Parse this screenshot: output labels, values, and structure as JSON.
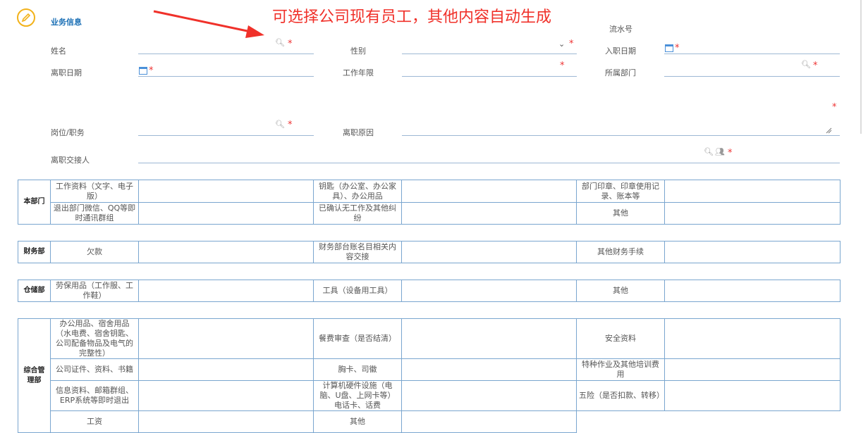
{
  "header": {
    "section_title": "业务信息",
    "annotation": "可选择公司现有员工，其他内容自动生成"
  },
  "form": {
    "serial_label": "流水号",
    "name_label": "姓名",
    "gender_label": "性别",
    "hire_date_label": "入职日期",
    "leave_date_label": "离职日期",
    "work_years_label": "工作年限",
    "department_label": "所属部门",
    "position_label": "岗位/职务",
    "leave_reason_label": "离职原因",
    "handover_label": "离职交接人",
    "required_mark": "*"
  },
  "tables": [
    {
      "dept": "本部门",
      "rows": [
        [
          "工作资料（文字、电子版）",
          "钥匙（办公室、办公家具）、办公用品",
          "部门印章、印章使用记录、账本等"
        ],
        [
          "退出部门微信、QQ等即时通讯群组",
          "已确认无工作及其他纠纷",
          "其他"
        ]
      ]
    },
    {
      "dept": "财务部",
      "rows": [
        [
          "欠款",
          "财务部台账名目相关内容交接",
          "其他财务手续"
        ]
      ]
    },
    {
      "dept": "仓储部",
      "rows": [
        [
          "劳保用品（工作服、工作鞋）",
          "工具（设备用工具）",
          "其他"
        ]
      ]
    },
    {
      "dept": "综合管理部",
      "rows": [
        [
          "办公用品、宿舍用品（水电费、宿舍钥匙、公司配备物品及电气的完整性）",
          "餐费审查（是否结清）",
          "安全资料"
        ],
        [
          "公司证件、资料、书籍",
          "胸卡、司徽",
          "特种作业及其他培训费用"
        ],
        [
          "信息资料、邮箱群组、ERP系统等即时退出",
          "计算机硬件设施（电脑、U盘、上网卡等）电话卡、话费",
          "五险（是否扣款、转移）"
        ],
        [
          "工资",
          "其他",
          ""
        ]
      ]
    }
  ]
}
